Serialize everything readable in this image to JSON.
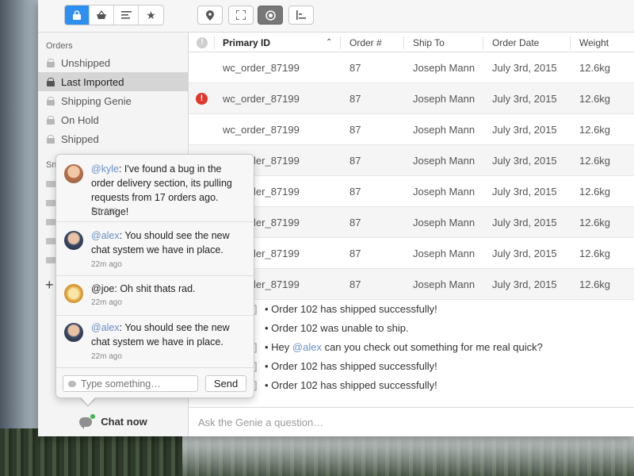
{
  "sidebar": {
    "orders_heading": "Orders",
    "smart_heading": "Sm",
    "items": [
      {
        "label": "Unshipped"
      },
      {
        "label": "Last Imported",
        "selected": true
      },
      {
        "label": "Shipping Genie"
      },
      {
        "label": "On Hold"
      },
      {
        "label": "Shipped"
      }
    ],
    "add_glyph": "+",
    "chat_label": "Chat now"
  },
  "table": {
    "columns": [
      "Primary ID",
      "Order #",
      "Ship To",
      "Order Date",
      "Weight"
    ],
    "alert_glyph": "!",
    "rows": [
      {
        "id": "wc_order_87199",
        "order": "87",
        "ship_to": "Joseph Mann",
        "date": "July 3rd, 2015",
        "weight": "12.6kg",
        "error": false
      },
      {
        "id": "wc_order_87199",
        "order": "87",
        "ship_to": "Joseph Mann",
        "date": "July 3rd, 2015",
        "weight": "12.6kg",
        "error": true
      },
      {
        "id": "wc_order_87199",
        "order": "87",
        "ship_to": "Joseph Mann",
        "date": "July 3rd, 2015",
        "weight": "12.6kg",
        "error": false
      },
      {
        "id": "wc_order_87199",
        "order": "87",
        "ship_to": "Joseph Mann",
        "date": "July 3rd, 2015",
        "weight": "12.6kg",
        "error": false
      },
      {
        "id": "wc_order_87199",
        "order": "87",
        "ship_to": "Joseph Mann",
        "date": "July 3rd, 2015",
        "weight": "12.6kg",
        "error": false
      },
      {
        "id": "wc_order_87199",
        "order": "87",
        "ship_to": "Joseph Mann",
        "date": "July 3rd, 2015",
        "weight": "12.6kg",
        "error": false
      },
      {
        "id": "wc_order_87199",
        "order": "87",
        "ship_to": "Joseph Mann",
        "date": "July 3rd, 2015",
        "weight": "12.6kg",
        "error": false
      },
      {
        "id": "wc_order_87199",
        "order": "87",
        "ship_to": "Joseph Mann",
        "date": "July 3rd, 2015",
        "weight": "12.6kg",
        "error": false
      }
    ]
  },
  "log": [
    {
      "ts": "5 ]",
      "text": "• Order 102 has shipped successfully!"
    },
    {
      "ts": "]",
      "text": "• Order 102 was unable to ship."
    },
    {
      "ts": "5 ]",
      "pre": "• Hey ",
      "mention": "@alex",
      "post": " can you check out something for me real quick?"
    },
    {
      "ts": "5 ]",
      "text": "• Order 102 has shipped successfully!"
    },
    {
      "ts": "5 ]",
      "text": "• Order 102 has shipped successfully!"
    }
  ],
  "ask_placeholder": "Ask the Genie a question…",
  "chat": {
    "messages": [
      {
        "user": "@kyle",
        "text": ": I've found a bug in the order delivery section, its pulling requests from 17 orders ago. Strange!",
        "time": "2m ago",
        "mention_color": true
      },
      {
        "user": "@alex",
        "text": ": You should see the new chat system we have in place.",
        "time": "22m ago",
        "mention_color": true
      },
      {
        "user": "@joe",
        "text": ": Oh shit thats rad.",
        "time": "22m ago",
        "mention_color": false
      },
      {
        "user": "@alex",
        "text": ": You should see the new chat system we have in place.",
        "time": "22m ago",
        "mention_color": true
      }
    ],
    "input_placeholder": "Type something…",
    "send_label": "Send"
  },
  "colors": {
    "accent": "#2f8ff0",
    "mention": "#6a8fc6",
    "error": "#e0382b",
    "online": "#3db84a"
  }
}
